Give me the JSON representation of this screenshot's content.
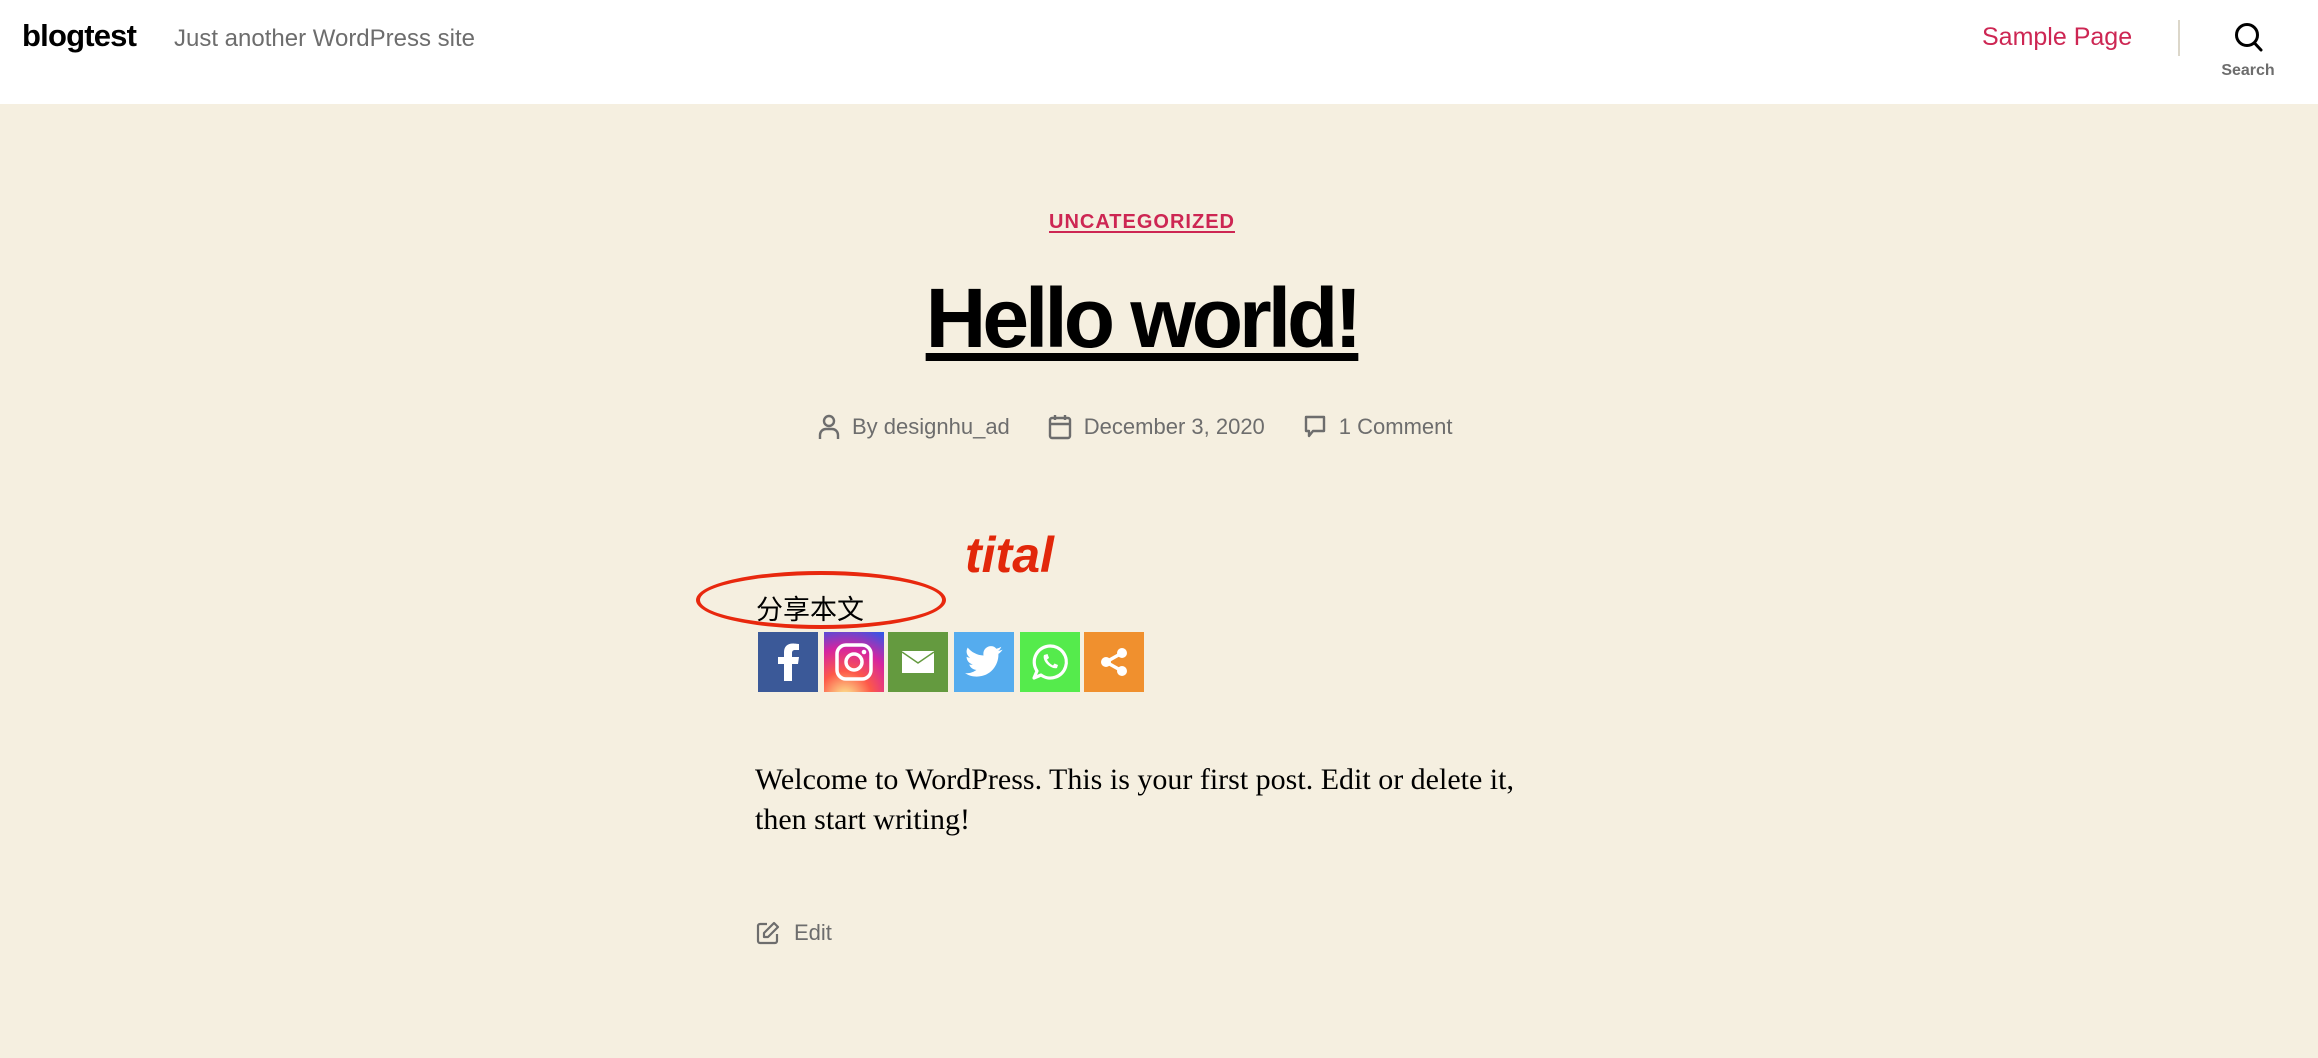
{
  "header": {
    "site_title": "blogtest",
    "site_description": "Just another WordPress site",
    "nav": [
      {
        "label": "Sample Page"
      }
    ],
    "search_label": "Search",
    "accent_color": "#cd2653"
  },
  "post": {
    "category": "UNCATEGORIZED",
    "title": "Hello world!",
    "meta": {
      "author": "By designhu_ad",
      "date": "December 3, 2020",
      "comments": "1 Comment"
    },
    "share": {
      "label": "分享本文",
      "buttons": [
        {
          "name": "Facebook",
          "icon": "facebook-icon",
          "color": "#3b5998"
        },
        {
          "name": "Instagram",
          "icon": "instagram-icon",
          "color": "#c13584"
        },
        {
          "name": "Email",
          "icon": "email-icon",
          "color": "#649a3f"
        },
        {
          "name": "Twitter",
          "icon": "twitter-icon",
          "color": "#55acee"
        },
        {
          "name": "WhatsApp",
          "icon": "whatsapp-icon",
          "color": "#55eb4c"
        },
        {
          "name": "Share",
          "icon": "share-icon",
          "color": "#f0902e"
        }
      ]
    },
    "content": "Welcome to WordPress. This is your first post. Edit or delete it, then start writing!",
    "edit_label": "Edit"
  },
  "annotation": {
    "text": "tital",
    "color": "#e2270a"
  }
}
